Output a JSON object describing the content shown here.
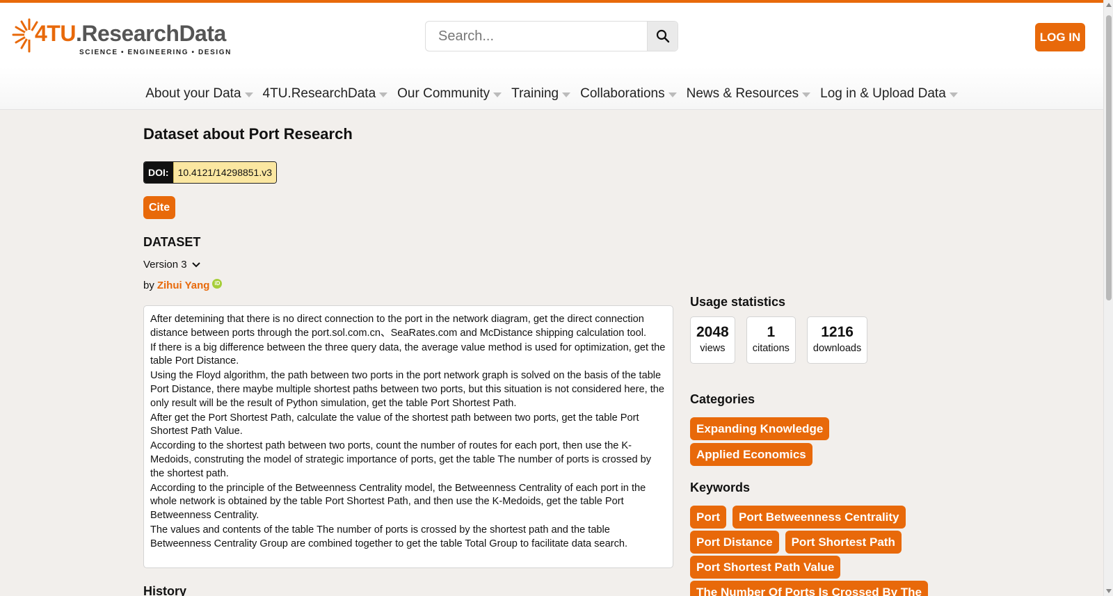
{
  "colors": {
    "accent": "#e8690a",
    "doi_bg": "#fbe7a1",
    "background": "#f2efec"
  },
  "header": {
    "logo_number": "4TU",
    "logo_name": ".ResearchData",
    "logo_tagline": "SCIENCE • ENGINEERING • DESIGN",
    "search_placeholder": "Search...",
    "search_icon": "magnifier-icon",
    "login_label": "LOG IN"
  },
  "nav": {
    "items": [
      {
        "label": "About your Data"
      },
      {
        "label": "4TU.ResearchData"
      },
      {
        "label": "Our Community"
      },
      {
        "label": "Training"
      },
      {
        "label": "Collaborations"
      },
      {
        "label": "News & Resources"
      },
      {
        "label": "Log in & Upload Data"
      }
    ]
  },
  "dataset": {
    "title": "Dataset about Port Research",
    "doi_label": "DOI:",
    "doi_value": "10.4121/14298851.v3",
    "cite_label": "Cite",
    "type_label": "DATASET",
    "version_label": "Version 3",
    "by_label": "by",
    "author": "Zihui Yang",
    "orcid_icon": "orcid-icon",
    "description": [
      "After detemining that there is no direct connection to the port in the network diagram, get the direct connection distance between ports through the port.sol.com.cn、SeaRates.com and McDistance shipping calculation tool.",
      "If there is a big difference between the three query data, the average value method is used for optimization, get the table Port Distance.",
      "Using the Floyd algorithm, the path between two ports in the port network graph is solved on the basis of the table Port Distance, there maybe multiple shortest paths between two ports, but this situation is not considered here, the only result will be the result of Python simulation, get the table Port Shortest Path.",
      "After get the Port Shortest Path, calculate the value of the shortest path between two ports, get the table Port Shortest Path Value.",
      "According to the shortest path between two ports, count the number of routes for each port, then use the K-Medoids, construting the model of strategic importance of ports, get the table The number of ports is crossed by the shortest path.",
      "According to the principle of the Betweenness Centrality model, the Betweenness Centrality of each port in the whole network is obtained by the table Port Shortest Path, and then use the K-Medoids, get the table Port Betweenness Centrality.",
      "The values and contents of the table The number of ports is crossed by the shortest path and the table Betweenness Centrality Group are combined together to get the table Total Group to facilitate data search."
    ],
    "history_label": "History"
  },
  "sidebar": {
    "usage_title": "Usage statistics",
    "stats": [
      {
        "value": "2048",
        "label": "views"
      },
      {
        "value": "1",
        "label": "citations"
      },
      {
        "value": "1216",
        "label": "downloads"
      }
    ],
    "categories_title": "Categories",
    "categories": [
      "Expanding Knowledge",
      "Applied Economics"
    ],
    "keywords_title": "Keywords",
    "keywords": [
      "Port",
      "Port Betweenness Centrality",
      "Port Distance",
      "Port Shortest Path",
      "Port Shortest Path Value",
      "The Number Of Ports Is Crossed By The"
    ]
  }
}
